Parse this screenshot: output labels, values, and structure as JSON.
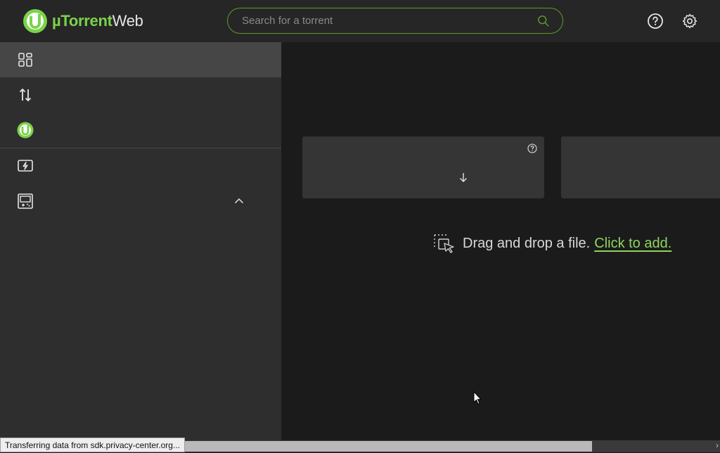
{
  "app": {
    "brand": "µTorrent",
    "suffix": "Web"
  },
  "search": {
    "placeholder": "Search for a torrent"
  },
  "header": {
    "icons": [
      "help-icon",
      "settings-icon"
    ]
  },
  "sidebar": {
    "items": [
      {
        "icon": "dashboard-grid-icon",
        "active": true
      },
      {
        "icon": "transfer-arrows-icon"
      },
      {
        "icon": "utorrent-logo-icon"
      },
      {
        "icon": "lightning-screen-icon"
      },
      {
        "icon": "media-player-icon",
        "expandable": true
      }
    ]
  },
  "main": {
    "drop_text": "Drag and drop a file.",
    "click_add": "Click to add."
  },
  "status": {
    "text": "Transferring data from sdk.privacy-center.org..."
  },
  "colors": {
    "accent": "#7bd34a",
    "bg": "#1b1b1b",
    "sidebar": "#2e2e2e",
    "active": "#464646"
  }
}
